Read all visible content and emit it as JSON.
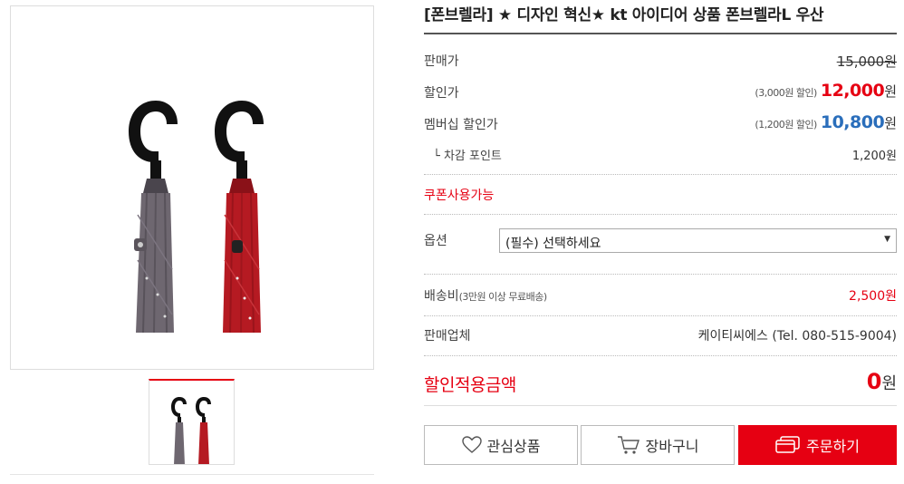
{
  "product": {
    "title": "[폰브렐라] ★ 디자인 혁신★ kt 아이디어 상품 폰브렐라L 우산",
    "main_image_alt": "폰브렐라 우산 (회색, 빨강)",
    "thumbnail_alt": "폰브렐라 우산 썸네일"
  },
  "price": {
    "list_label": "판매가",
    "list_value": "15,000원",
    "sale_label": "할인가",
    "sale_discount": "(3,000원 할인)",
    "sale_value": "12,000",
    "member_label": "멤버십 할인가",
    "member_discount": "(1,200원 할인)",
    "member_value": "10,800",
    "won": "원",
    "point_label": "└ 차감 포인트",
    "point_value": "1,200원"
  },
  "coupon": {
    "label": "쿠폰사용가능"
  },
  "option": {
    "label": "옵션",
    "selected": "(필수) 선택하세요"
  },
  "shipping": {
    "label": "배송비",
    "note": "(3만원 이상 무료배송)",
    "value": "2,500원"
  },
  "seller": {
    "label": "판매업체",
    "value": "케이티씨에스 (Tel. 080-515-9004)"
  },
  "total": {
    "label": "할인적용금액",
    "value": "0",
    "won": "원"
  },
  "buttons": {
    "wish": "관심상품",
    "cart": "장바구니",
    "order": "주문하기"
  },
  "colors": {
    "accent": "#e60012",
    "member_blue": "#2a6ebb",
    "umbrella_gray": "#6e6770",
    "umbrella_red": "#b51a22"
  }
}
